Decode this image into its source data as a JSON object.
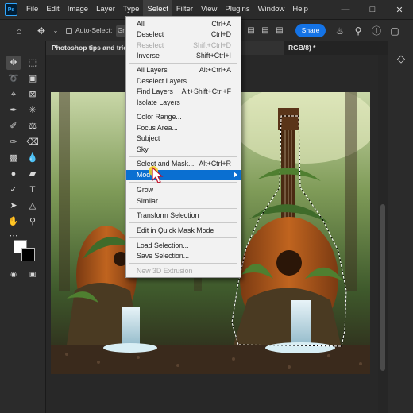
{
  "app": {
    "logo": "Ps"
  },
  "menubar": {
    "items": [
      "File",
      "Edit",
      "Image",
      "Layer",
      "Type",
      "Select",
      "Filter",
      "View",
      "Plugins",
      "Window",
      "Help"
    ],
    "active": "Select",
    "window_controls": [
      "minimize-icon",
      "maximize-icon",
      "close-icon"
    ]
  },
  "options_bar": {
    "auto_select_label": "Auto-Select:",
    "group_value": "Gr",
    "share_label": "Share"
  },
  "document_tab": {
    "title": "Photoshop tips and tric",
    "suffix": "RGB/8) *"
  },
  "select_menu": {
    "items": [
      {
        "label": "All",
        "shortcut": "Ctrl+A",
        "state": "normal"
      },
      {
        "label": "Deselect",
        "shortcut": "Ctrl+D",
        "state": "normal"
      },
      {
        "label": "Reselect",
        "shortcut": "Shift+Ctrl+D",
        "state": "disabled"
      },
      {
        "label": "Inverse",
        "shortcut": "Shift+Ctrl+I",
        "state": "normal"
      },
      {
        "label": "All Layers",
        "shortcut": "Alt+Ctrl+A",
        "state": "normal"
      },
      {
        "label": "Deselect Layers",
        "shortcut": "",
        "state": "normal"
      },
      {
        "label": "Find Layers",
        "shortcut": "Alt+Shift+Ctrl+F",
        "state": "normal"
      },
      {
        "label": "Isolate Layers",
        "shortcut": "",
        "state": "normal"
      },
      {
        "label": "Color Range...",
        "shortcut": "",
        "state": "normal"
      },
      {
        "label": "Focus Area...",
        "shortcut": "",
        "state": "normal"
      },
      {
        "label": "Subject",
        "shortcut": "",
        "state": "normal"
      },
      {
        "label": "Sky",
        "shortcut": "",
        "state": "normal"
      },
      {
        "label": "Select and Mask...",
        "shortcut": "Alt+Ctrl+R",
        "state": "normal"
      },
      {
        "label": "Mod",
        "shortcut": "",
        "state": "highlight"
      },
      {
        "label": "Grow",
        "shortcut": "",
        "state": "normal"
      },
      {
        "label": "Similar",
        "shortcut": "",
        "state": "normal"
      },
      {
        "label": "Transform Selection",
        "shortcut": "",
        "state": "normal"
      },
      {
        "label": "Edit in Quick Mask Mode",
        "shortcut": "",
        "state": "normal"
      },
      {
        "label": "Load Selection...",
        "shortcut": "",
        "state": "normal"
      },
      {
        "label": "Save Selection...",
        "shortcut": "",
        "state": "normal"
      },
      {
        "label": "New 3D Extrusion",
        "shortcut": "",
        "state": "disabled"
      }
    ]
  },
  "colors": {
    "menu_highlight": "#0a6fd1",
    "share_button": "#1473e6",
    "menu_background": "#f2f2f2"
  }
}
